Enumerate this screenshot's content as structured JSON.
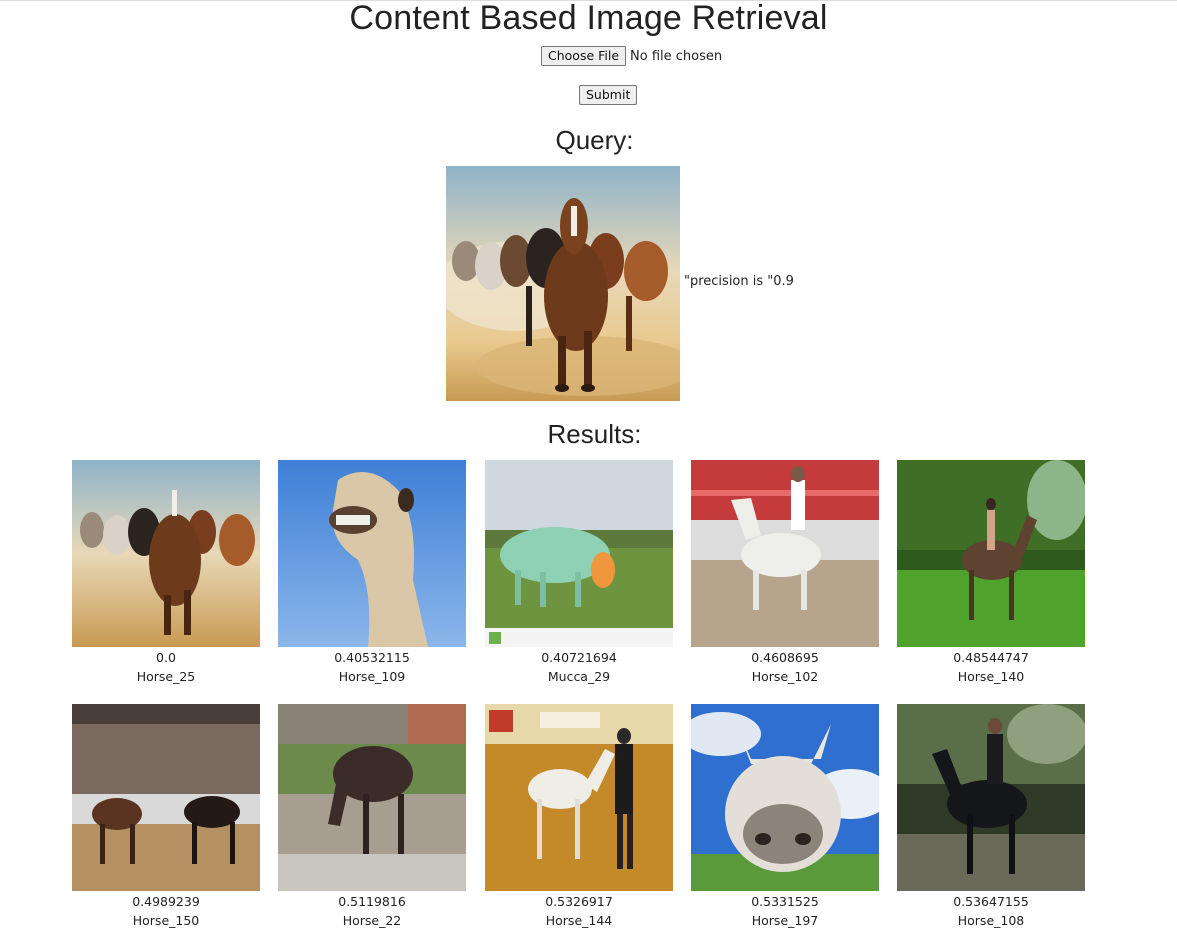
{
  "page": {
    "title": "Content Based Image Retrieval"
  },
  "upload": {
    "choose_label": "Choose File",
    "status": "No file chosen",
    "submit_label": "Submit"
  },
  "query": {
    "heading": "Query:",
    "precision_text": "\"precision is \"0.9"
  },
  "results": {
    "heading": "Results:",
    "items": [
      {
        "score": "0.0",
        "label": "Horse_25"
      },
      {
        "score": "0.40532115",
        "label": "Horse_109"
      },
      {
        "score": "0.40721694",
        "label": "Mucca_29"
      },
      {
        "score": "0.4608695",
        "label": "Horse_102"
      },
      {
        "score": "0.48544747",
        "label": "Horse_140"
      },
      {
        "score": "0.4989239",
        "label": "Horse_150"
      },
      {
        "score": "0.5119816",
        "label": "Horse_22"
      },
      {
        "score": "0.5326917",
        "label": "Horse_144"
      },
      {
        "score": "0.5331525",
        "label": "Horse_197"
      },
      {
        "score": "0.53647155",
        "label": "Horse_108"
      }
    ]
  }
}
